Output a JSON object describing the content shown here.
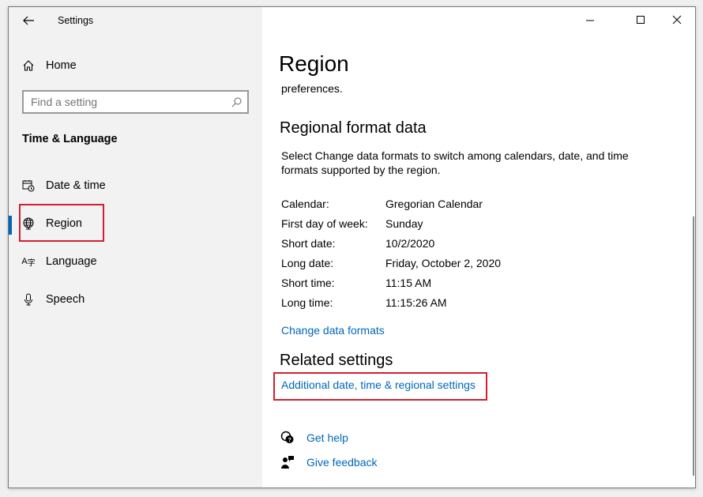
{
  "window": {
    "title": "Settings",
    "controls": {
      "minimize": "minimize-icon",
      "maximize": "maximize-icon",
      "close": "close-icon"
    }
  },
  "sidebar": {
    "home": "Home",
    "search": {
      "placeholder": "Find a setting",
      "value": ""
    },
    "section": "Time & Language",
    "items": [
      {
        "label": "Date & time",
        "icon": "calendar-clock-icon"
      },
      {
        "label": "Region",
        "icon": "globe-icon",
        "selected": true
      },
      {
        "label": "Language",
        "icon": "language-icon"
      },
      {
        "label": "Speech",
        "icon": "microphone-icon"
      }
    ]
  },
  "main": {
    "title": "Region",
    "preface": "preferences.",
    "format_heading": "Regional format data",
    "format_desc": "Select Change data formats to switch among calendars, date, and time formats supported by the region.",
    "rows": [
      {
        "label": "Calendar:",
        "value": "Gregorian Calendar"
      },
      {
        "label": "First day of week:",
        "value": "Sunday"
      },
      {
        "label": "Short date:",
        "value": "10/2/2020"
      },
      {
        "label": "Long date:",
        "value": "Friday, October 2, 2020"
      },
      {
        "label": "Short time:",
        "value": "11:15 AM"
      },
      {
        "label": "Long time:",
        "value": "11:15:26 AM"
      }
    ],
    "change_link": "Change data formats",
    "related_heading": "Related settings",
    "related_link": "Additional date, time & regional settings",
    "help": "Get help",
    "feedback": "Give feedback"
  },
  "colors": {
    "accent": "#0067b8",
    "highlight": "#d0202e",
    "sidebar": "#f2f2f2"
  }
}
